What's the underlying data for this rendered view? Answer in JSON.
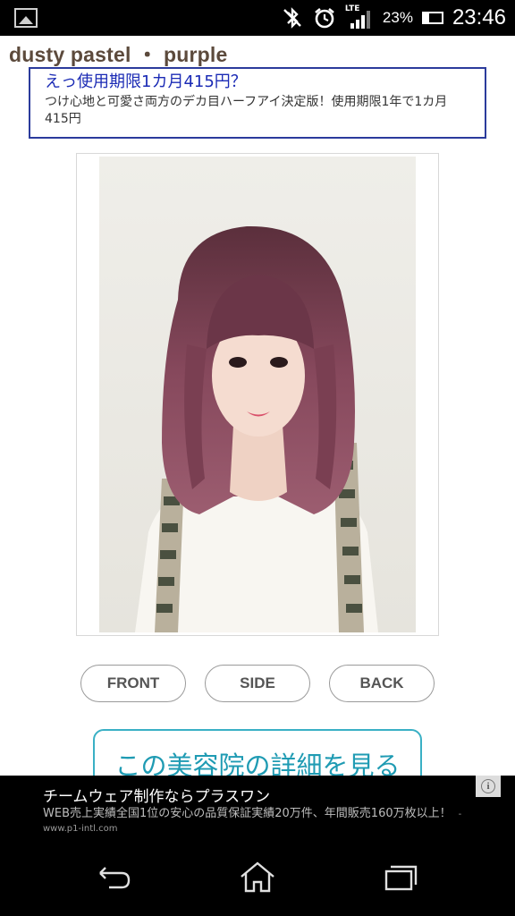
{
  "status_bar": {
    "icons": [
      "gallery-icon",
      "bluetooth-icon",
      "alarm-icon",
      "signal-icon",
      "battery-icon"
    ],
    "network": "LTE",
    "battery": "23%",
    "time": "23:46"
  },
  "page": {
    "title": "dusty pastel ・ purple"
  },
  "ad_top": {
    "headline": "えっ使用期限1カ月415円？",
    "body": "つけ心地と可愛さ両方のデカ目ハーフアイ決定版！使用期限1年で1カ月415円"
  },
  "gallery": {
    "buttons": [
      "FRONT",
      "SIDE",
      "BACK"
    ]
  },
  "detail_button": "この美容院の詳細を見る",
  "ad_bottom": {
    "headline": "チームウェア制作ならプラスワン",
    "body": "WEB売上実績全国1位の安心の品質保証実績20万件、年間販売160万枚以上！",
    "url": "- www.p1-intl.com",
    "info_icon": "i"
  },
  "nav": {
    "items": [
      "back-icon",
      "home-icon",
      "recents-icon"
    ]
  },
  "colors": {
    "title": "#5c4a3c",
    "ad_border": "#2b3b9c",
    "ad_headline": "#1b2bb5",
    "detail_accent": "#3ab0c5",
    "hair": "#7a3f52"
  }
}
